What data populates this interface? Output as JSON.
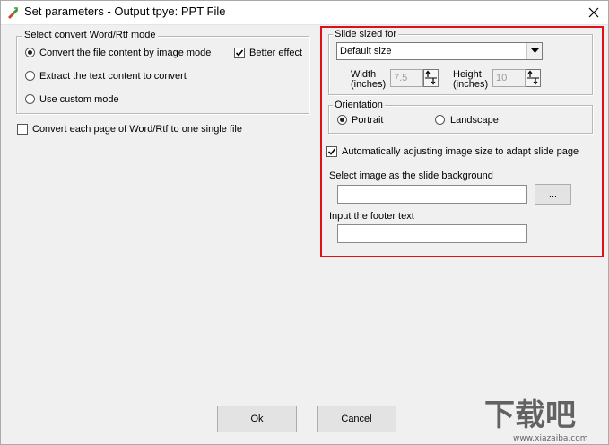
{
  "window": {
    "title": "Set parameters - Output tpye: PPT File",
    "close_glyph": "✕"
  },
  "convert_mode": {
    "group_label": "Select convert Word/Rtf mode",
    "options": [
      {
        "label": "Convert the file content by image mode",
        "selected": true
      },
      {
        "label": "Extract the text content to convert",
        "selected": false
      },
      {
        "label": "Use custom mode",
        "selected": false
      }
    ],
    "better_effect": {
      "label": "Better effect",
      "checked": true
    }
  },
  "single_file": {
    "label": "Convert each page of Word/Rtf to one single file",
    "checked": false
  },
  "slide_size": {
    "group_label": "Slide sized for",
    "selected": "Default size",
    "width_label_1": "Width",
    "width_label_2": "(inches)",
    "width_value": "7.5",
    "height_label_1": "Height",
    "height_label_2": "(inches)",
    "height_value": "10"
  },
  "orientation": {
    "group_label": "Orientation",
    "options": [
      {
        "label": "Portrait",
        "selected": true
      },
      {
        "label": "Landscape",
        "selected": false
      }
    ]
  },
  "auto_adjust": {
    "label": "Automatically adjusting image size to adapt slide page",
    "checked": true
  },
  "background": {
    "label": "Select image as the slide background",
    "value": "",
    "browse_label": "..."
  },
  "footer": {
    "label": "Input the footer text",
    "value": ""
  },
  "buttons": {
    "ok": "Ok",
    "cancel": "Cancel"
  },
  "colors": {
    "highlight_frame": "#e0101a",
    "check_mark": "#000000"
  },
  "watermark": {
    "text_cn": "下载吧",
    "text_url": "www.xiazaiba.com"
  }
}
